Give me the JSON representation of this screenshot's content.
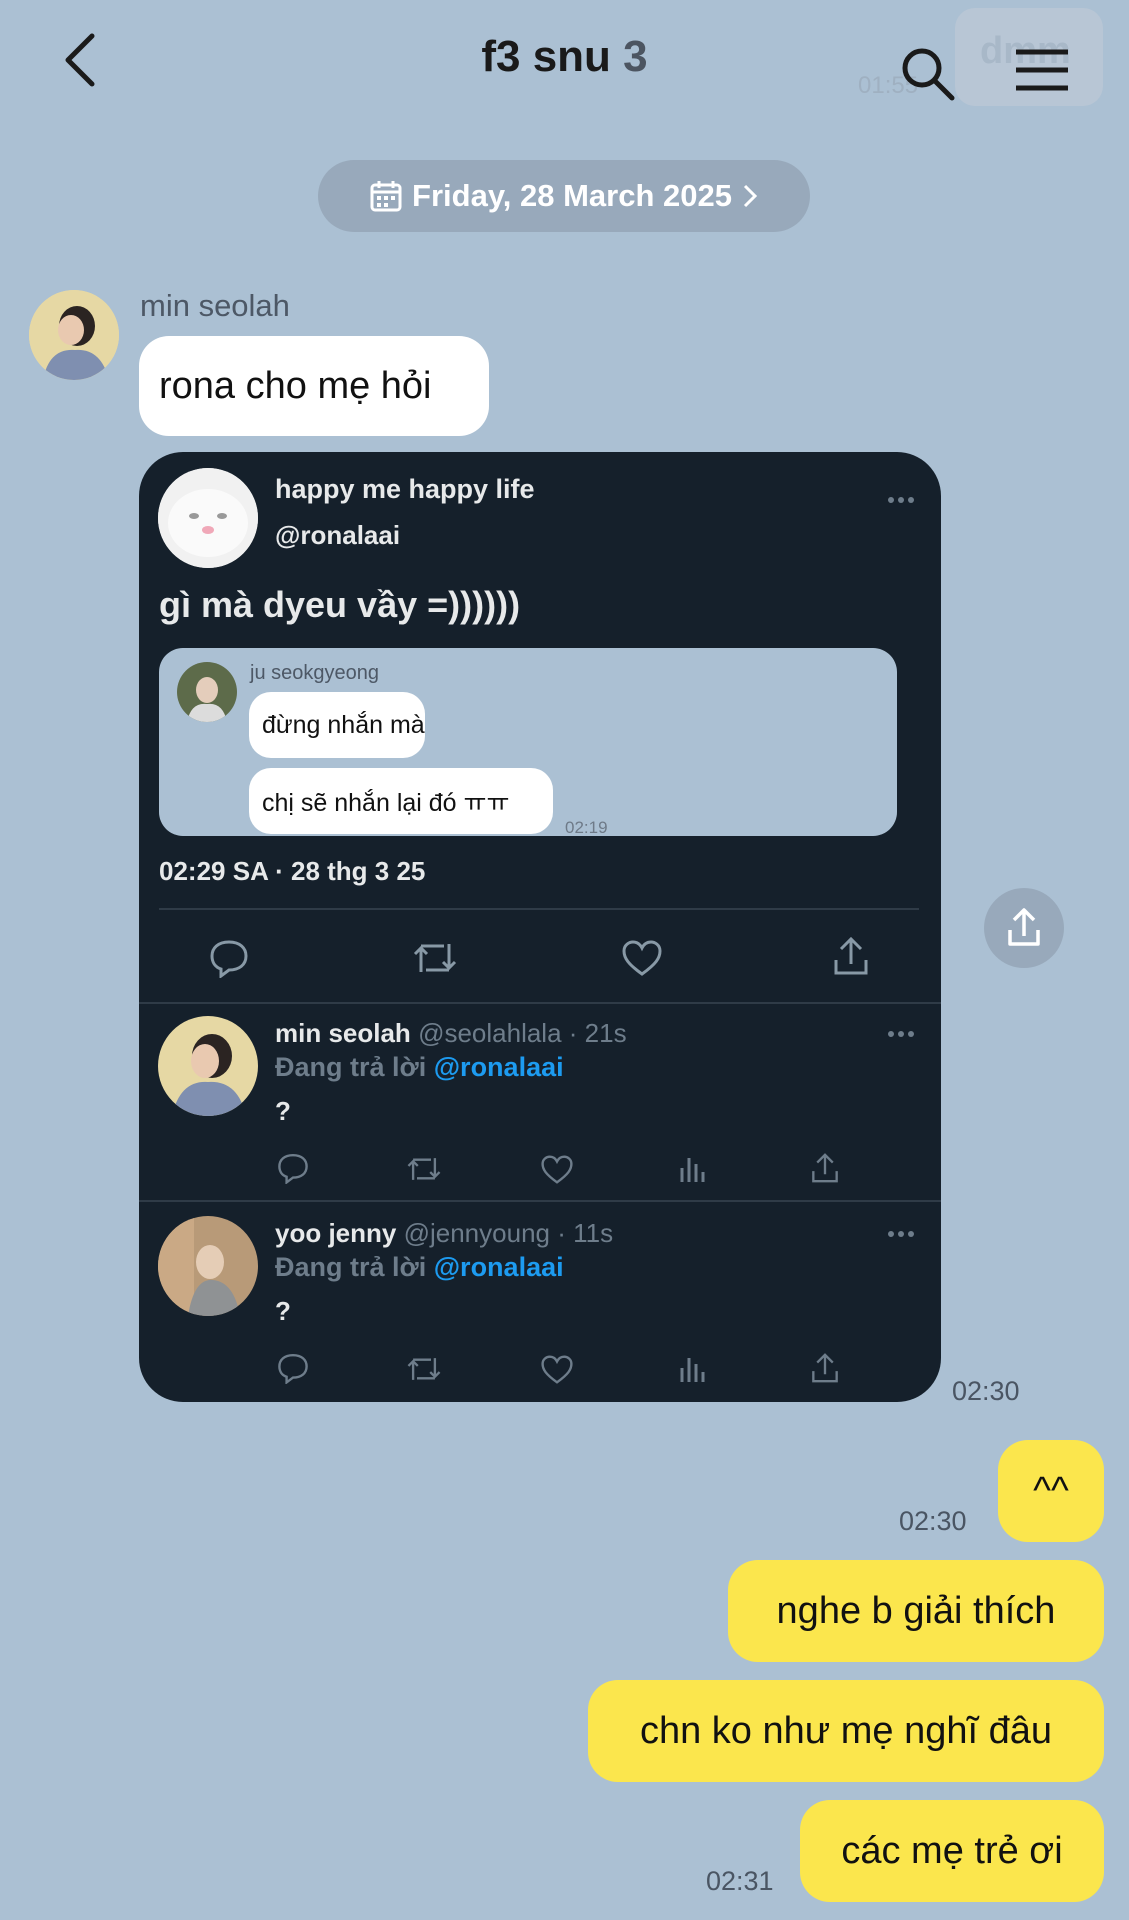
{
  "header": {
    "title": "f3 snu",
    "member_count": "3",
    "ghost_text": "dmm",
    "ghost_time": "01:55",
    "icons": [
      "back-arrow-icon",
      "search-icon",
      "menu-icon"
    ]
  },
  "date_pill": {
    "label": "Friday, 28 March 2025",
    "icon": "calendar-icon"
  },
  "messages": {
    "sender_name": "min seolah",
    "incoming_text": "rona cho mẹ hỏi",
    "shared_time": "02:30",
    "out": [
      {
        "text": "^^",
        "time": "02:30"
      },
      {
        "text": "nghe b giải thích"
      },
      {
        "text": "chn ko như mẹ nghĩ đâu"
      },
      {
        "text": "các mẹ trẻ ơi",
        "time": "02:31"
      }
    ]
  },
  "tweet": {
    "display_name": "happy me happy life",
    "handle": "@ronalaai",
    "text": "gì mà dyeu vầy =))))))",
    "quoted": {
      "name": "ju seokgyeong",
      "lines": [
        "đừng nhắn mà",
        "chị sẽ nhắn lại đó ㅠㅠ"
      ],
      "time": "02:19"
    },
    "meta": "02:29 SA · 28 thg 3 25",
    "replies": [
      {
        "name": "min seolah",
        "handle": "@seolahlala · 21s",
        "replying_prefix": "Đang trả lời",
        "replying_to": "@ronalaai",
        "text": "?"
      },
      {
        "name": "yoo jenny",
        "handle": "@jennyoung · 11s",
        "replying_prefix": "Đang trả lời",
        "replying_to": "@ronalaai",
        "text": "?"
      }
    ]
  },
  "colors": {
    "background": "#abc0d3",
    "outgoing_bubble": "#fbe64d",
    "incoming_bubble": "#ffffff",
    "tweet_card": "#15202b",
    "link": "#1d9bf0"
  }
}
